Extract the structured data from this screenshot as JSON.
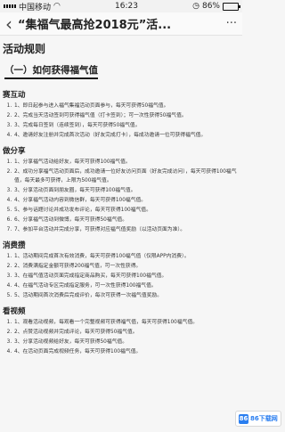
{
  "status_bar": {
    "carrier": "中国移动",
    "network": "WiFi",
    "time": "16:23",
    "battery": "86%",
    "battery_level": 0.86
  },
  "nav": {
    "title": "“集福气最高抢2018元”活...",
    "more": "···"
  },
  "content": {
    "rules_heading": "活动规则",
    "sub_heading": "（一）如何获得福气值",
    "sections": [
      {
        "title": "赛互动",
        "items": [
          "1、即日起参与进入福气集福活动页面参与，每天可获得50福气值。",
          "2、完成当天活动签到可获得福气值（打卡签到）；可一次性获得50福气值。",
          "3、完成每日签到（连续签到），每天可获得50福气值。",
          "4、邀请好友注册并完成首次活动（好友完成打卡），每成功邀请一位可获得福气值。"
        ]
      },
      {
        "title": "做分享",
        "items": [
          "1、分享福气活动给好友，每天可获得100福气值。",
          "2、成功分享福气活动页面后，成功邀请一位好友访问页面（好友完成访问），每天可获得100福气值，每天最多可获得，上限为500福气值。",
          "3、分享活动页面到朋友圈，每天可获得100福气值。",
          "4、分享福气活动内容到微信群，每天可获得100福气值。",
          "5、参与话题讨论并成功发布评论，每天可获得100福气值。",
          "6、分享福气活动到微博，每天可获得50福气值。",
          "7、参加平台活动并完成分享，可获得对应福气值奖励（以活动页面为准）。"
        ]
      },
      {
        "title": "消费攒",
        "items": [
          "1、活动期间完成首次有效消费，每天可获得100福气值（仅限APP内消费）。",
          "2、消费满指定金额可获得200福气值，可一次性获得。",
          "3、在福气值活动页面完成指定商品购买，每天可获得100福气值。",
          "4、在福气活动专区完成指定服务，可一次性获得100福气值。",
          "5、活动期间首次消费后完成评价，每次可获得一次福气值奖励。"
        ]
      },
      {
        "title": "看视频",
        "items": [
          "1、观看活动视频，每观看一个完整视频可获得福气值，每天可获得100福气值。",
          "2、点赞活动视频并完成评论，每天可获得50福气值。",
          "3、分享活动视频给好友，每天可获得50福气值。",
          "4、在活动页面完成视频任务，每天可获得100福气值。"
        ]
      }
    ]
  },
  "watermark": {
    "logo": "86",
    "text": "86下载网"
  }
}
